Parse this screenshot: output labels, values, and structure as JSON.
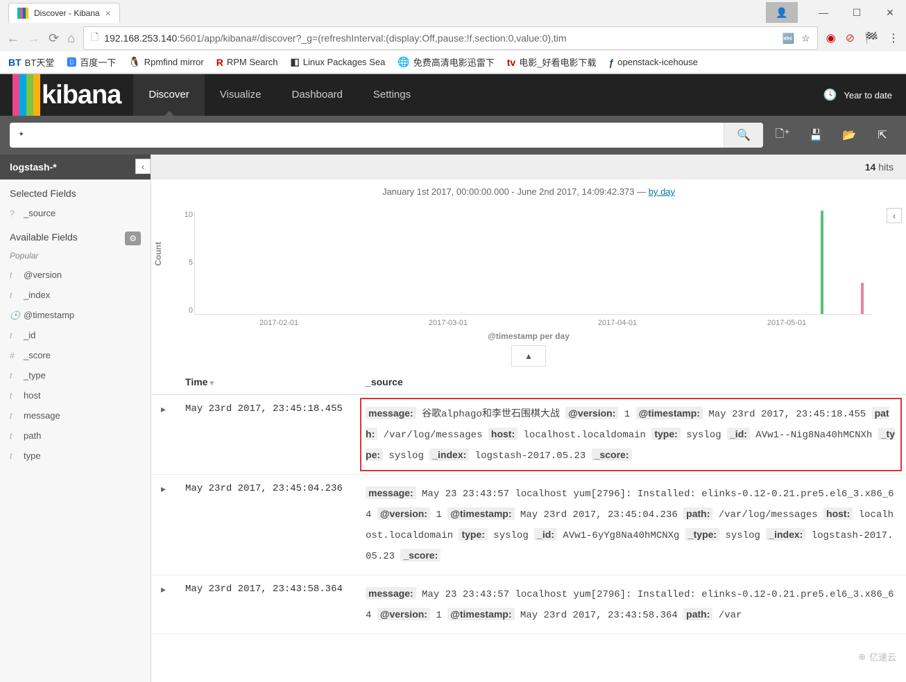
{
  "browser": {
    "tab_title": "Discover - Kibana",
    "url_host": "192.168.253.140",
    "url_port_path": ":5601/app/kibana#/discover?_g=(refreshInterval:(display:Off,pause:!f,section:0,value:0),tim",
    "bookmarks": [
      {
        "icon": "BT",
        "label": "BT天堂",
        "color": "#0055aa"
      },
      {
        "icon": "🅱",
        "label": "百度一下",
        "color": "#3385ff"
      },
      {
        "icon": "🐧",
        "label": "Rpmfind mirror",
        "color": "#333"
      },
      {
        "icon": "R",
        "label": "RPM Search",
        "color": "#cc0000"
      },
      {
        "icon": "◧",
        "label": "Linux Packages Sea",
        "color": "#333"
      },
      {
        "icon": "🌐",
        "label": "免费高清电影迅雷下",
        "color": "#0aa"
      },
      {
        "icon": "tv",
        "label": "电影_好看电影下载",
        "color": "#c00"
      },
      {
        "icon": "ƒ",
        "label": "openstack-icehouse",
        "color": "#294172"
      }
    ]
  },
  "kibana": {
    "nav": [
      "Discover",
      "Visualize",
      "Dashboard",
      "Settings"
    ],
    "active_nav": 0,
    "time_label": "Year to date",
    "search_value": "*",
    "index_pattern": "logstash-*",
    "hits_label": "14 hits",
    "hits_num": "14",
    "hits_word": " hits"
  },
  "sidebar": {
    "selected_label": "Selected Fields",
    "source_field": "_source",
    "available_label": "Available Fields",
    "popular_label": "Popular",
    "fields": [
      {
        "ic": "t",
        "name": "@version"
      },
      {
        "ic": "t",
        "name": "_index"
      },
      {
        "ic": "🕒",
        "name": "@timestamp"
      },
      {
        "ic": "t",
        "name": "_id"
      },
      {
        "ic": "#",
        "name": "_score"
      },
      {
        "ic": "t",
        "name": "_type"
      },
      {
        "ic": "t",
        "name": "host"
      },
      {
        "ic": "t",
        "name": "message"
      },
      {
        "ic": "t",
        "name": "path"
      },
      {
        "ic": "t",
        "name": "type"
      }
    ]
  },
  "chart_data": {
    "type": "bar",
    "title_range": "January 1st 2017, 00:00:00.000 - June 2nd 2017, 14:09:42.373 — ",
    "title_link": "by day",
    "ylabel": "Count",
    "xlabel": "@timestamp per day",
    "y_ticks": [
      "10",
      "5",
      "0"
    ],
    "x_ticks": [
      "2017-02-01",
      "2017-03-01",
      "2017-04-01",
      "2017-05-01"
    ],
    "bars": [
      {
        "pos_pct": 92.5,
        "height_pct": 100,
        "color": "#57c17b"
      },
      {
        "pos_pct": 98.5,
        "height_pct": 30,
        "color": "#e9839d"
      }
    ],
    "ylim": [
      0,
      14
    ]
  },
  "table": {
    "col_time": "Time",
    "col_source": "_source",
    "rows": [
      {
        "time": "May 23rd 2017, 23:45:18.455",
        "highlight": true,
        "pairs": [
          [
            "message:",
            "谷歌alphago和李世石围棋大战"
          ],
          [
            "@version:",
            "1"
          ],
          [
            "@timestamp:",
            "May 23rd 2017, 23:45:18.455"
          ],
          [
            "path:",
            "/var/log/messages"
          ],
          [
            "host:",
            "localhost.localdomain"
          ],
          [
            "type:",
            "syslog"
          ],
          [
            "_id:",
            "AVw1--Nig8Na40hMCNXh"
          ],
          [
            "_type:",
            "syslog"
          ],
          [
            "_index:",
            "logstash-2017.05.23"
          ],
          [
            "_score:",
            ""
          ]
        ]
      },
      {
        "time": "May 23rd 2017, 23:45:04.236",
        "highlight": false,
        "pairs": [
          [
            "message:",
            "May 23 23:43:57 localhost yum[2796]: Installed: elinks-0.12-0.21.pre5.el6_3.x86_64"
          ],
          [
            "@version:",
            "1"
          ],
          [
            "@timestamp:",
            "May 23rd 2017, 23:45:04.236"
          ],
          [
            "path:",
            "/var/log/messages"
          ],
          [
            "host:",
            "localhost.localdomain"
          ],
          [
            "type:",
            "syslog"
          ],
          [
            "_id:",
            "AVw1-6yYg8Na40hMCNXg"
          ],
          [
            "_type:",
            "syslog"
          ],
          [
            "_index:",
            "logstash-2017.05.23"
          ],
          [
            "_score:",
            ""
          ]
        ]
      },
      {
        "time": "May 23rd 2017, 23:43:58.364",
        "highlight": false,
        "pairs": [
          [
            "message:",
            "May 23 23:43:57 localhost yum[2796]: Installed: elinks-0.12-0.21.pre5.el6_3.x86_64"
          ],
          [
            "@version:",
            "1"
          ],
          [
            "@timestamp:",
            "May 23rd 2017, 23:43:58.364"
          ],
          [
            "path:",
            "/var"
          ]
        ]
      }
    ]
  },
  "watermark": "亿速云"
}
